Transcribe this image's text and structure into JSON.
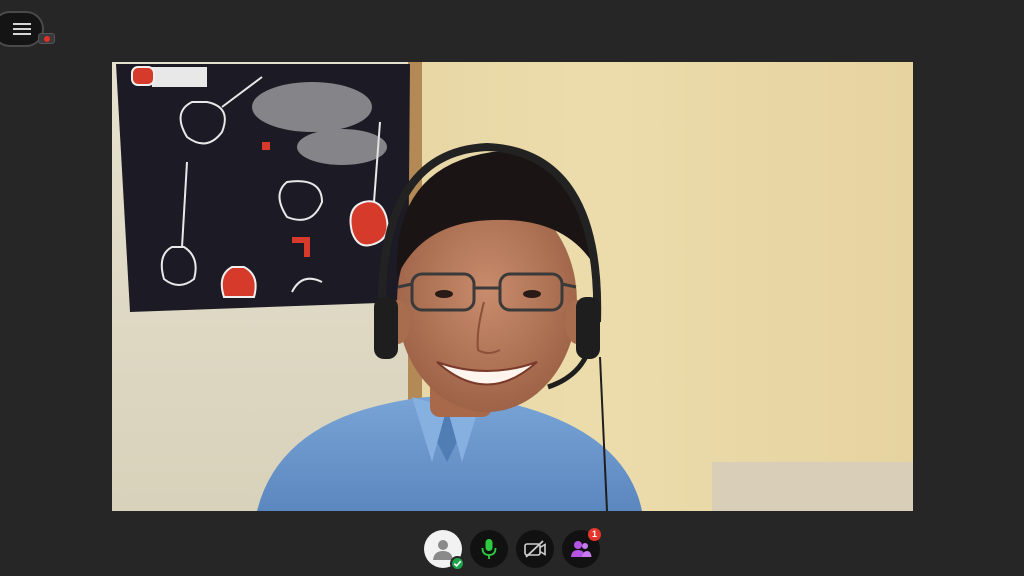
{
  "app": {
    "menu_icon": "hamburger-icon",
    "recording_indicator_icon": "recording-dot-icon"
  },
  "video": {
    "description_icon": "participant-video-feed"
  },
  "toolbar": {
    "buttons": [
      {
        "icon": "user-avatar-icon",
        "status_icon": "check-icon"
      },
      {
        "icon": "microphone-icon"
      },
      {
        "icon": "camera-off-icon"
      },
      {
        "icon": "participants-icon",
        "badge": "1"
      }
    ]
  },
  "colors": {
    "background": "#262626",
    "mic_accent": "#2ecc40",
    "participants_accent": "#b455e6",
    "badge_red": "#e5372b",
    "status_green": "#1fa34a"
  }
}
